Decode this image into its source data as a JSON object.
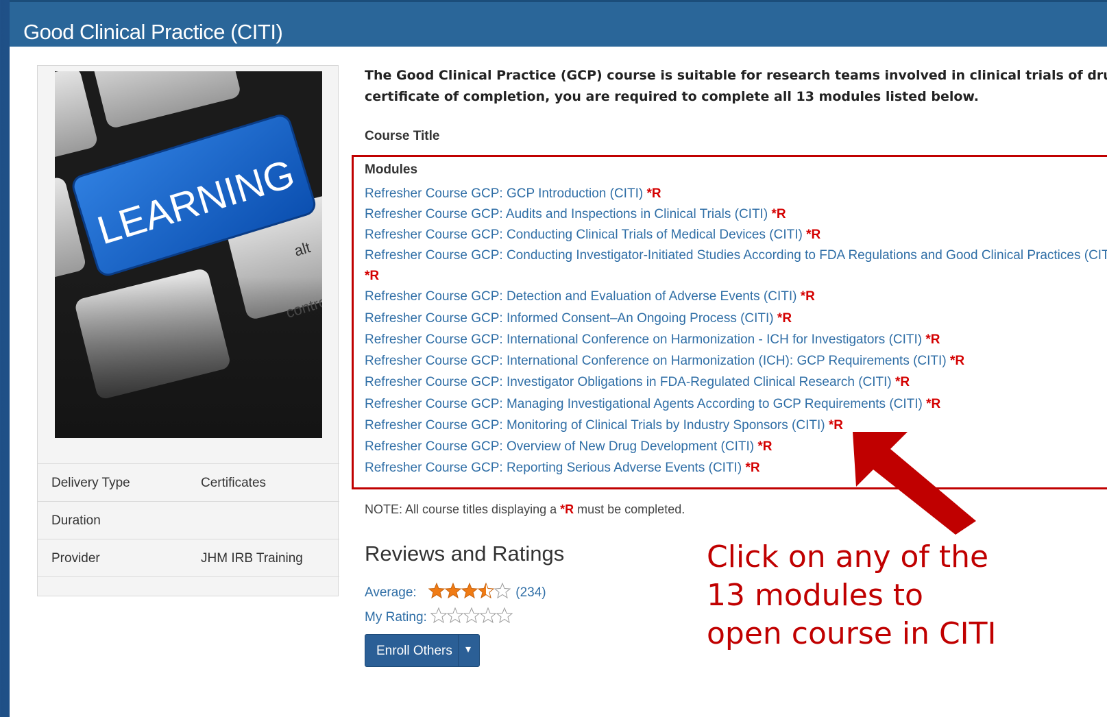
{
  "page": {
    "title": "Good Clinical Practice (CITI)"
  },
  "image": {
    "label": "LEARNING",
    "key_alt": "alt",
    "key_ctrl": "control"
  },
  "details": [
    {
      "key": "Delivery Type",
      "value": "Certificates"
    },
    {
      "key": "Duration",
      "value": ""
    },
    {
      "key": "Provider",
      "value": "JHM IRB Training"
    }
  ],
  "description": {
    "line1": "The Good Clinical Practice (GCP) course is suitable for research teams involved in clinical trials of drugs,",
    "line2": "certificate of completion, you are required to complete all 13 modules listed below."
  },
  "course_title_header": "Course Title",
  "modules_header": "Modules",
  "required_marker": "*R",
  "modules": [
    "Refresher Course GCP: GCP Introduction (CITI)",
    "Refresher Course GCP: Audits and Inspections in Clinical Trials (CITI)",
    "Refresher Course GCP: Conducting Clinical Trials of Medical Devices (CITI)",
    "Refresher Course GCP: Conducting Investigator-Initiated Studies According to FDA Regulations and Good Clinical Practices (CITI)",
    "Refresher Course GCP: Detection and Evaluation of Adverse Events (CITI)",
    "Refresher Course GCP: Informed Consent–An Ongoing Process (CITI)",
    "Refresher Course GCP: International Conference on Harmonization - ICH for Investigators (CITI)",
    "Refresher Course GCP: International Conference on Harmonization (ICH): GCP Requirements (CITI)",
    "Refresher Course GCP: Investigator Obligations in FDA-Regulated Clinical Research (CITI)",
    "Refresher Course GCP: Managing Investigational Agents According to GCP Requirements (CITI)",
    "Refresher Course GCP: Monitoring of Clinical Trials by Industry Sponsors (CITI)",
    "Refresher Course GCP: Overview of New Drug Development (CITI)",
    "Refresher Course GCP: Reporting Serious Adverse Events (CITI)"
  ],
  "note": {
    "prefix": "NOTE: All course titles displaying a ",
    "marker": "*R",
    "suffix": " must be completed."
  },
  "reviews": {
    "heading": "Reviews and Ratings",
    "average_label": "Average:",
    "average_rating": 3.5,
    "max_rating": 5,
    "count": "(234)",
    "my_rating_label": "My Rating:",
    "my_rating": 0
  },
  "enroll_button": {
    "label": "Enroll Others"
  },
  "callout": {
    "line1": "Click on any of the",
    "line2": "13 modules to",
    "line3": "open course in CITI"
  },
  "colors": {
    "header_bg": "#2a6699",
    "link": "#2f6ea6",
    "required": "#d40000",
    "highlight": "#c00000"
  }
}
